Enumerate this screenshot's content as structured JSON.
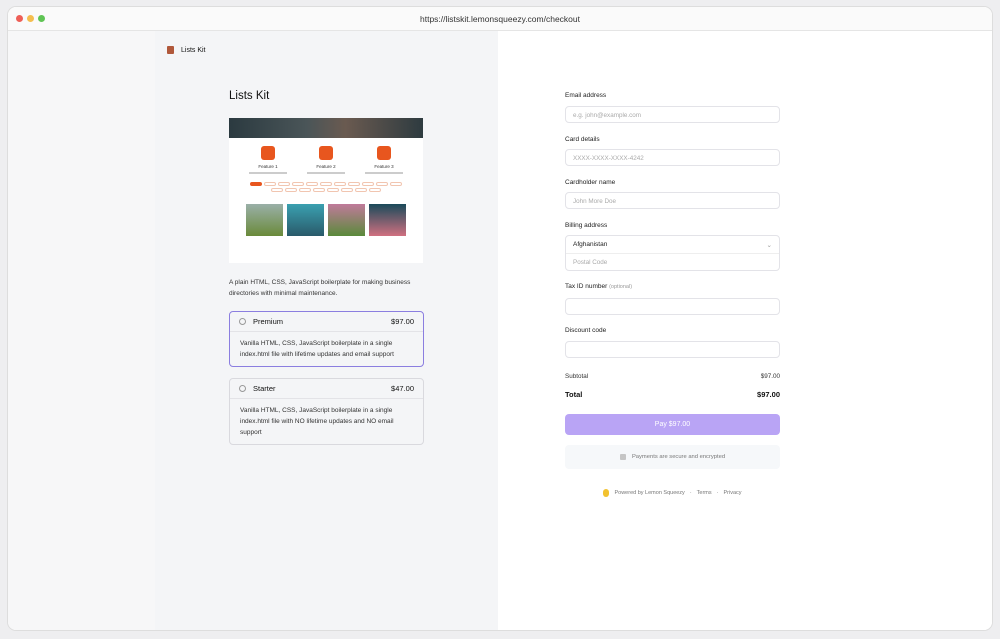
{
  "browser": {
    "url": "https://listskit.lemonsqueezy.com/checkout"
  },
  "store": {
    "name": "Lists Kit"
  },
  "product": {
    "title": "Lists Kit",
    "description": "A plain HTML, CSS, JavaScript boilerplate for making business directories with minimal maintenance.",
    "image_features": [
      "Feature 1",
      "Feature 2",
      "Feature 3"
    ]
  },
  "plans": [
    {
      "name": "Premium",
      "price": "$97.00",
      "description": "Vanilla HTML, CSS, JavaScript boilerplate in a single index.html file with lifetime updates and email support",
      "selected": true
    },
    {
      "name": "Starter",
      "price": "$47.00",
      "description": "Vanilla HTML, CSS, JavaScript boilerplate in a single index.html file with NO lifetime updates and NO email support",
      "selected": false
    }
  ],
  "form": {
    "email_label": "Email address",
    "email_placeholder": "e.g. john@example.com",
    "card_label": "Card details",
    "card_placeholder": "XXXX-XXXX-XXXX-4242",
    "name_label": "Cardholder name",
    "name_placeholder": "John More Doe",
    "billing_label": "Billing address",
    "country": "Afghanistan",
    "postal_placeholder": "Postal Code",
    "tax_label": "Tax ID number",
    "tax_optional": "(optional)",
    "discount_label": "Discount code"
  },
  "summary": {
    "subtotal_label": "Subtotal",
    "subtotal": "$97.00",
    "total_label": "Total",
    "total": "$97.00"
  },
  "pay_button": "Pay $97.00",
  "secure_text": "Payments are secure and encrypted",
  "footer": {
    "powered": "Powered by Lemon Squeezy",
    "terms": "Terms",
    "privacy": "Privacy",
    "sep": "·"
  },
  "colors": {
    "accent": "#b9a4f5",
    "selected_border": "#8b7ee0",
    "brand_orange": "#e8561e"
  }
}
